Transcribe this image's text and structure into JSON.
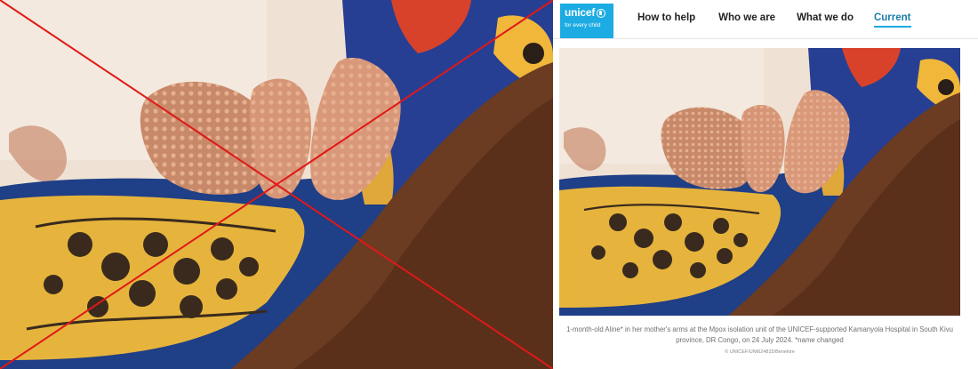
{
  "site": {
    "logo_word": "unicef",
    "logo_tagline": "for every child",
    "brand_color": "#1CABE2"
  },
  "nav": {
    "items": [
      "How to help",
      "Who we are",
      "What we do",
      "Current"
    ],
    "active_color": "#1a7ea8"
  },
  "article": {
    "caption": "1-month-old Aline* in her mother's arms at the Mpox isolation unit of the UNICEF-supported Kamanyola Hospital in South Kivu province, DR Congo, on 24 July 2024. *name changed",
    "credit": "© UNICEF/UNI624815/Benekire"
  },
  "overlay": {
    "x_mark_color": "#e01818"
  }
}
